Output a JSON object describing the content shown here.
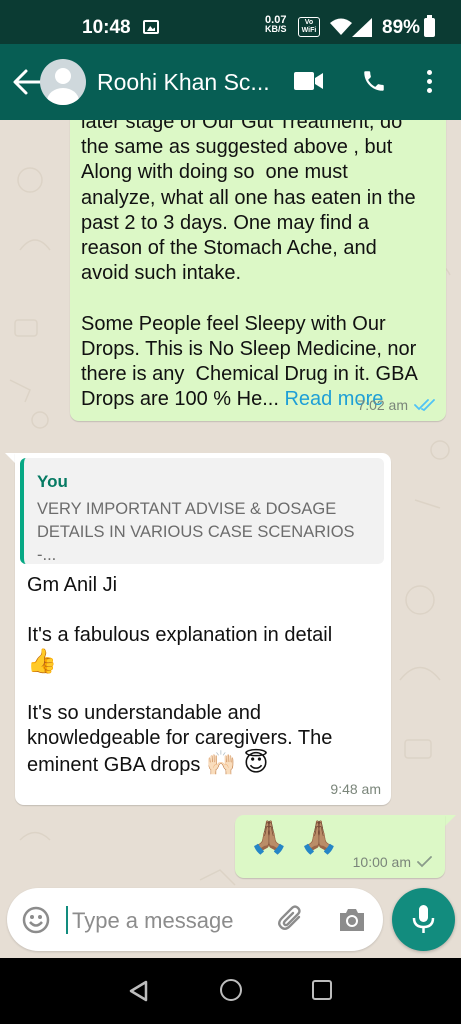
{
  "status_bar": {
    "time": "10:48",
    "speed_value": "0.07",
    "speed_unit": "KB/S",
    "vowifi": "Vo WiFi",
    "battery": "89%"
  },
  "header": {
    "contact_name": "Roohi Khan Sc..."
  },
  "messages": [
    {
      "direction": "outgoing",
      "text": "later stage of Our Gut Treatment, do the same as suggested above , but Along with doing so  one must analyze, what all one has eaten in the past 2 to 3 days. One may find a reason of the Stomach Ache, and avoid such intake.\n\nSome People feel Sleepy with Our Drops. This is No Sleep Medicine, nor there is any  Chemical Drug in it. GBA Drops are 100 % He... ",
      "read_more": "Read more",
      "time": "7:02 am",
      "status": "read"
    },
    {
      "direction": "incoming",
      "quote_author": "You",
      "quote_text": "VERY IMPORTANT ADVISE  & DOSAGE DETAILS IN VARIOUS CASE SCENARIOS -...",
      "line1": "Gm Anil Ji",
      "line2": "It's a fabulous explanation in detail",
      "line2_emoji": "👍",
      "line3": "It's so understandable and knowledgeable for caregivers. The eminent GBA drops ",
      "line3_emoji": "🙌🏻 😇",
      "time": "9:48 am"
    },
    {
      "direction": "outgoing",
      "text": "🙏🏽 🙏🏽",
      "time": "10:00 am",
      "status": "sent"
    }
  ],
  "input": {
    "placeholder": "Type a message"
  },
  "colors": {
    "header": "#075e54",
    "status_bar": "#0b3b33",
    "outgoing_bubble": "#dcf8c6",
    "incoming_bubble": "#ffffff",
    "accent": "#128c7e",
    "link": "#1e9fd6",
    "read_tick": "#4fc3f7"
  }
}
